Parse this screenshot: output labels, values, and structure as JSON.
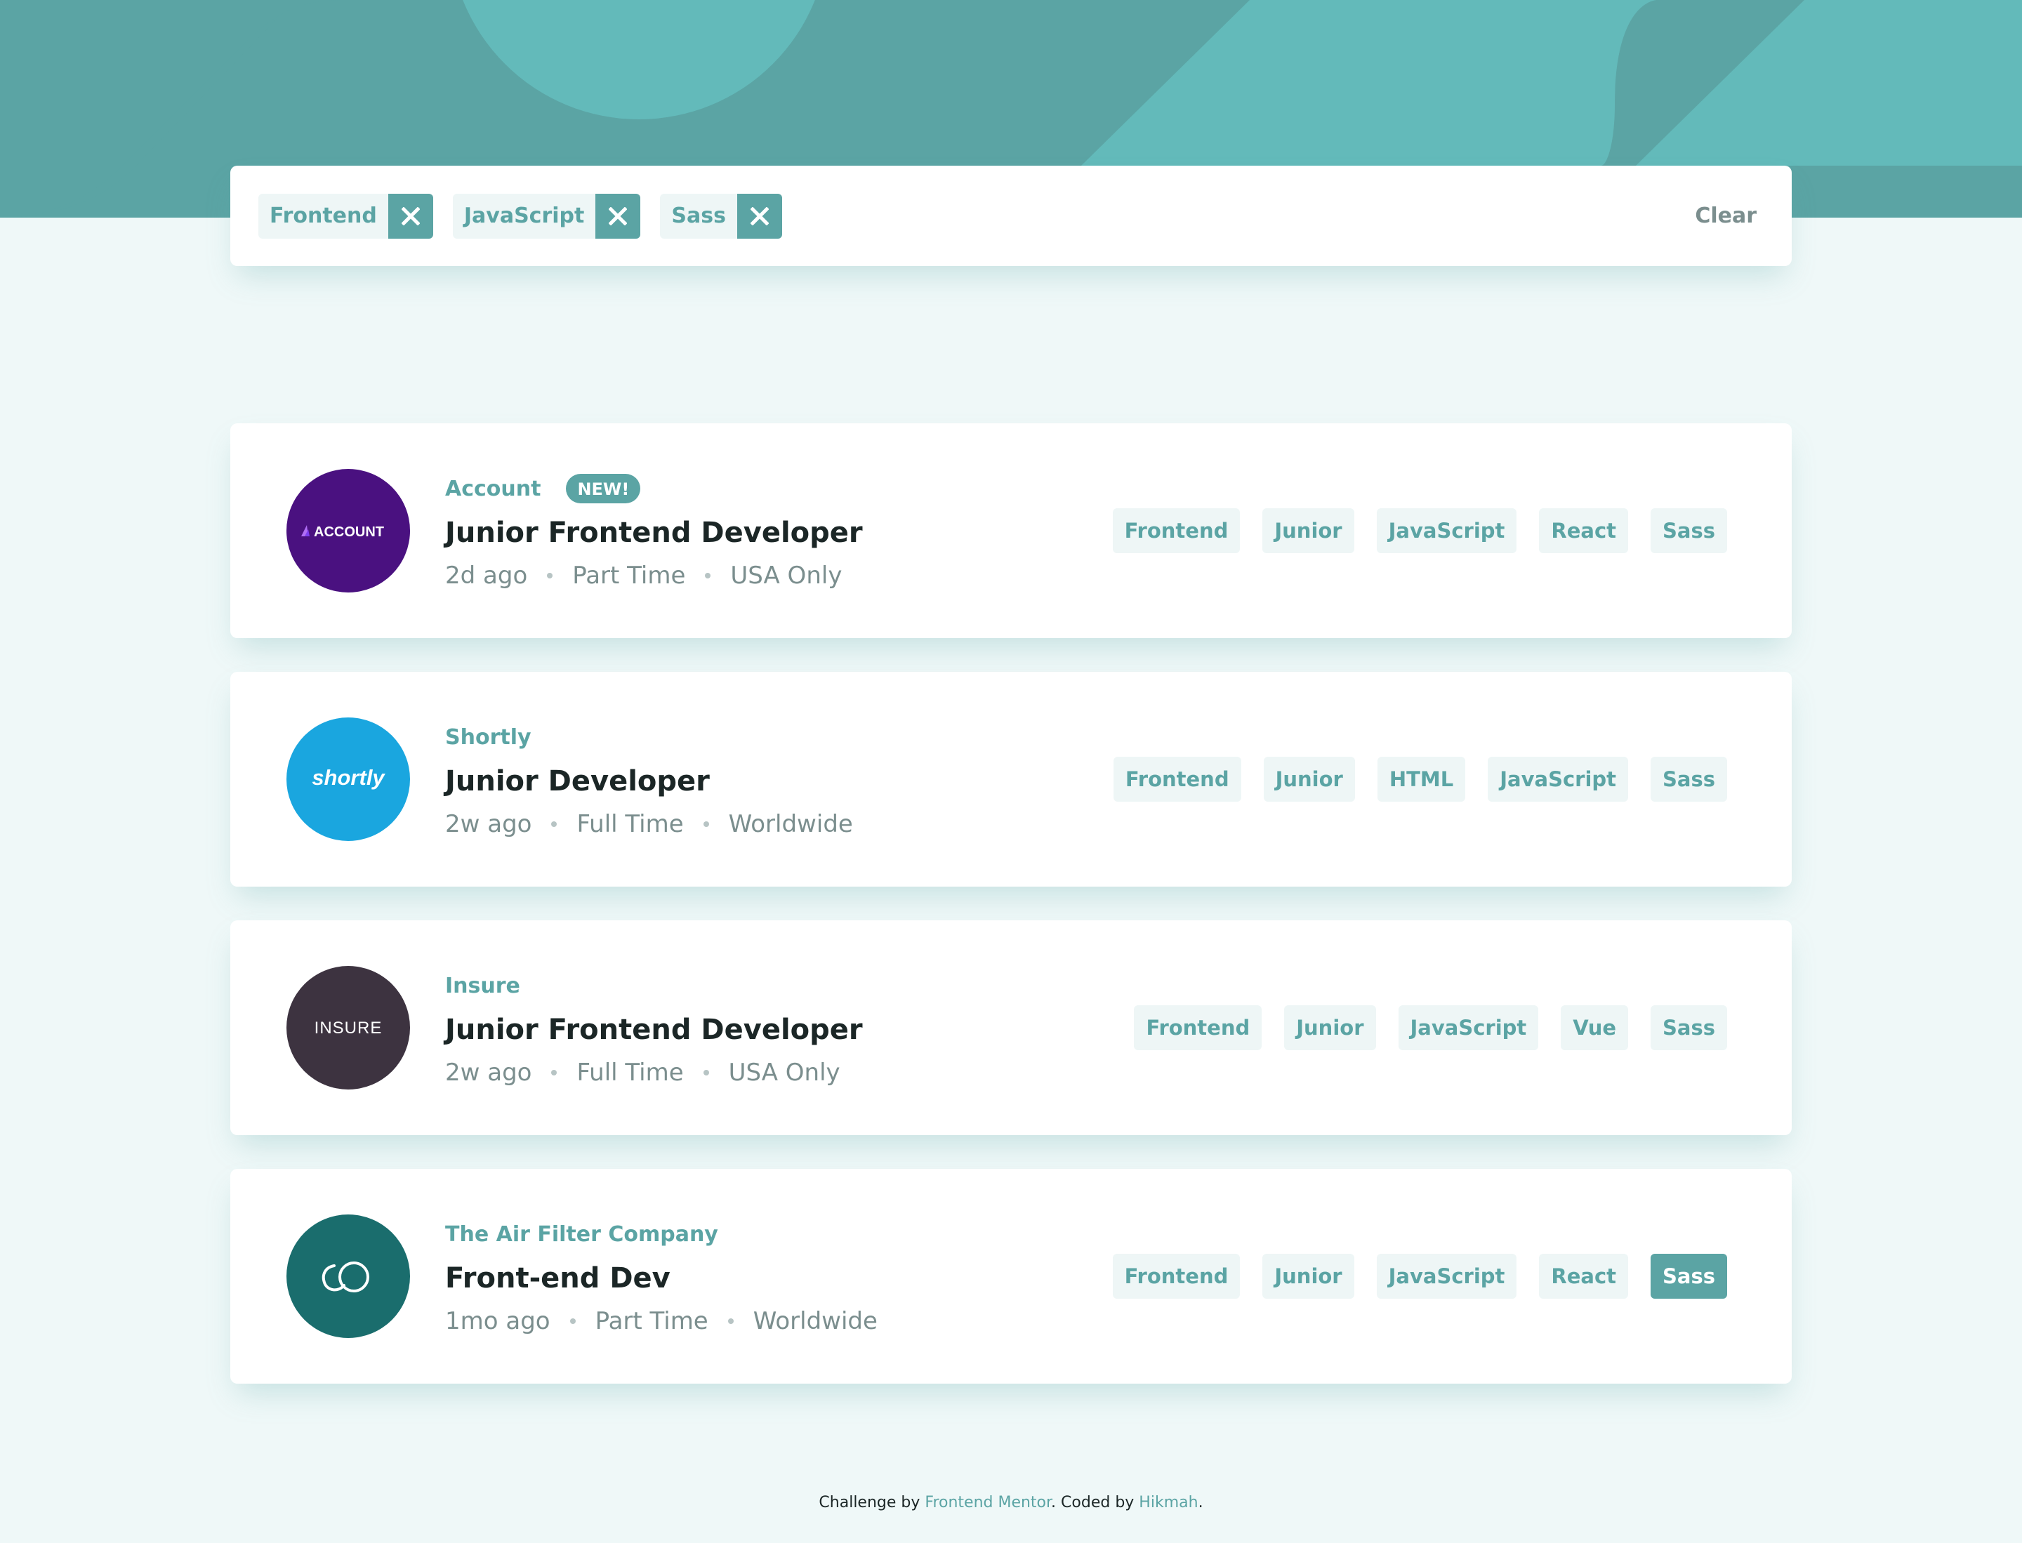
{
  "filters": {
    "chips": [
      {
        "label": "Frontend"
      },
      {
        "label": "JavaScript"
      },
      {
        "label": "Sass"
      }
    ],
    "clear_label": "Clear"
  },
  "jobs": [
    {
      "company": "Account",
      "logo_text": "ACCOUNT",
      "logo_color": "#4a1180",
      "new_badge": "NEW!",
      "position": "Junior Frontend Developer",
      "posted": "2d ago",
      "contract": "Part Time",
      "location": "USA Only",
      "tags": [
        "Frontend",
        "Junior",
        "JavaScript",
        "React",
        "Sass"
      ]
    },
    {
      "company": "Shortly",
      "logo_text": "shortly",
      "logo_color": "#1aa6df",
      "position": "Junior Developer",
      "posted": "2w ago",
      "contract": "Full Time",
      "location": "Worldwide",
      "tags": [
        "Frontend",
        "Junior",
        "HTML",
        "JavaScript",
        "Sass"
      ]
    },
    {
      "company": "Insure",
      "logo_text": "INSURE",
      "logo_color": "#3d3340",
      "position": "Junior Frontend Developer",
      "posted": "2w ago",
      "contract": "Full Time",
      "location": "USA Only",
      "tags": [
        "Frontend",
        "Junior",
        "JavaScript",
        "Vue",
        "Sass"
      ]
    },
    {
      "company": "The Air Filter Company",
      "logo_color": "#1a6d6d",
      "position": "Front-end Dev",
      "posted": "1mo ago",
      "contract": "Part Time",
      "location": "Worldwide",
      "tags": [
        "Frontend",
        "Junior",
        "JavaScript",
        "React",
        "Sass"
      ]
    }
  ],
  "footer": {
    "prefix": "Challenge by ",
    "mentor_link": "Frontend Mentor",
    "middle": ". Coded by ",
    "author_link": "Hikmah",
    "suffix": "."
  },
  "colors": {
    "primary": "#5ba4a4",
    "background": "#eff8f8",
    "tag_bg": "#eef6f6"
  }
}
